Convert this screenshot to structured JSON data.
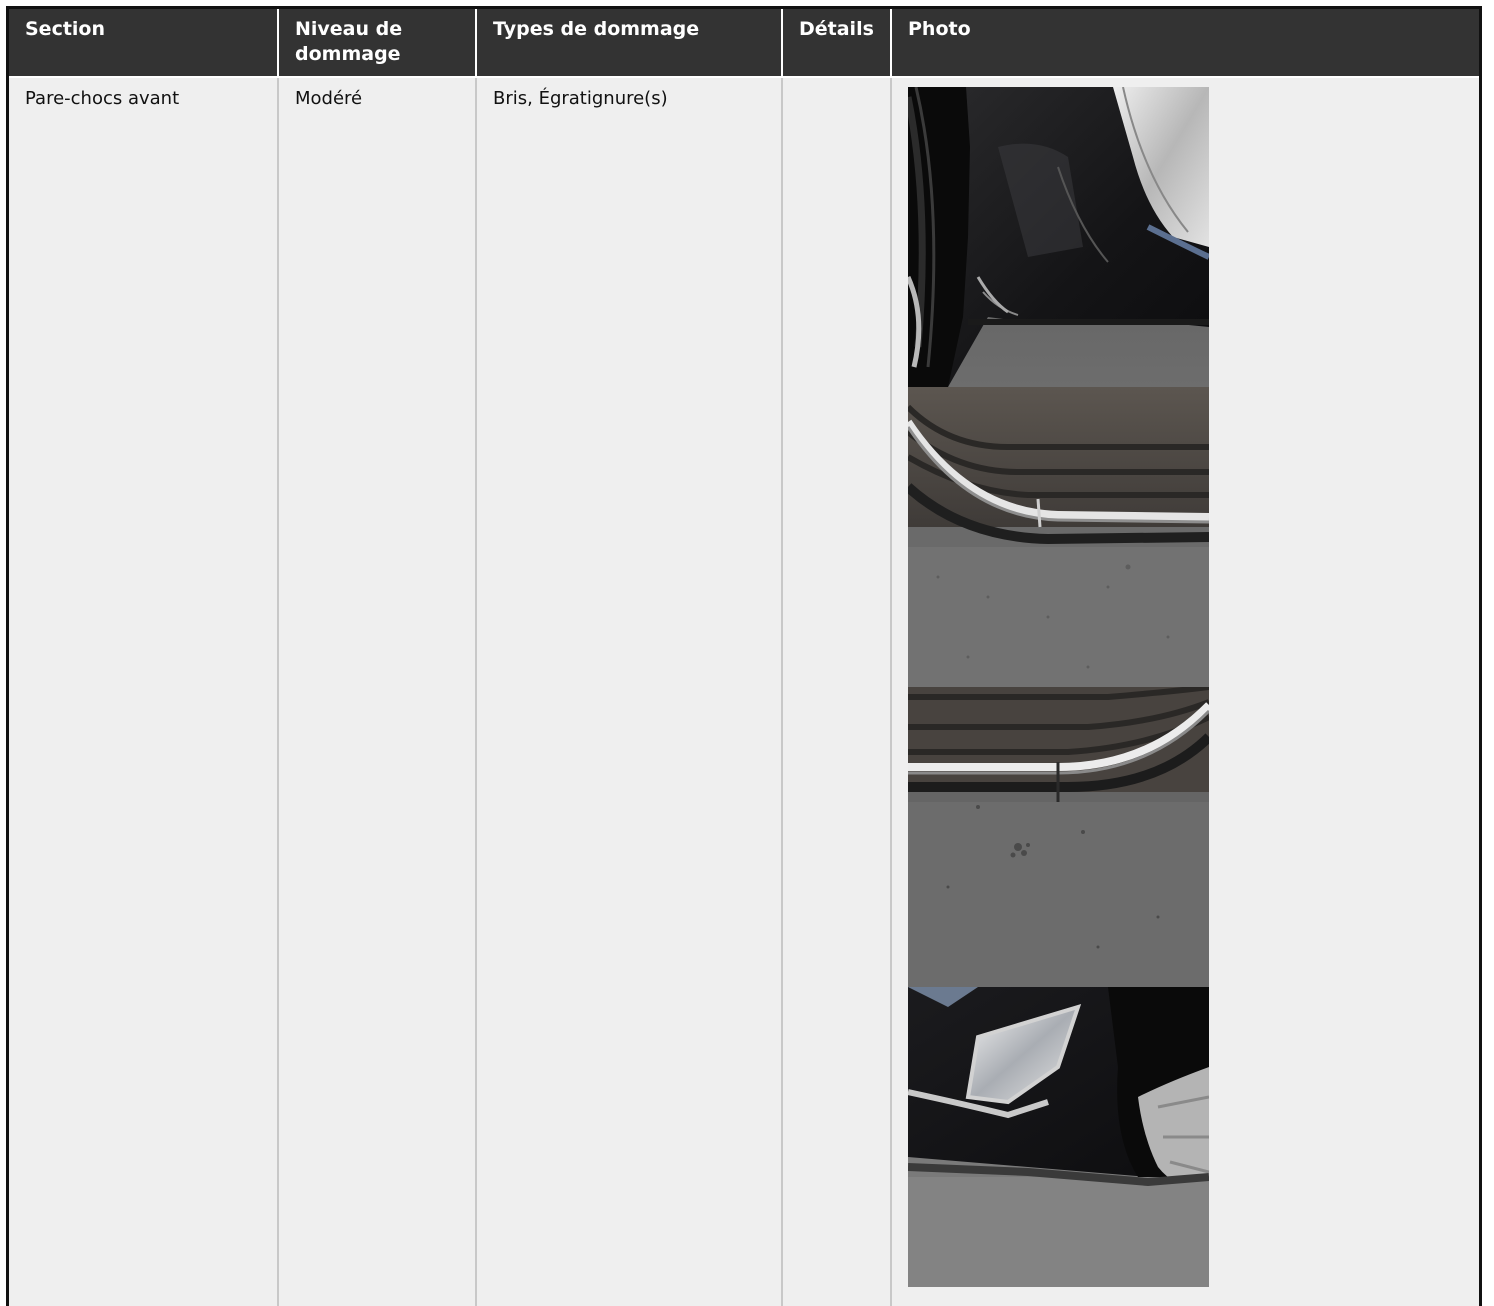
{
  "table": {
    "headers": [
      "Section",
      "Niveau de dommage",
      "Types de dommage",
      "Détails",
      "Photo"
    ],
    "rows": [
      {
        "section": "Pare-chocs avant",
        "level": "Modéré",
        "types": "Bris, Égratignure(s)",
        "details": "",
        "photos": [
          "photo-front-bumper-wheel-corner",
          "photo-front-grille-chrome-left",
          "photo-front-grille-chrome-right",
          "photo-fog-light-corner"
        ]
      }
    ]
  }
}
